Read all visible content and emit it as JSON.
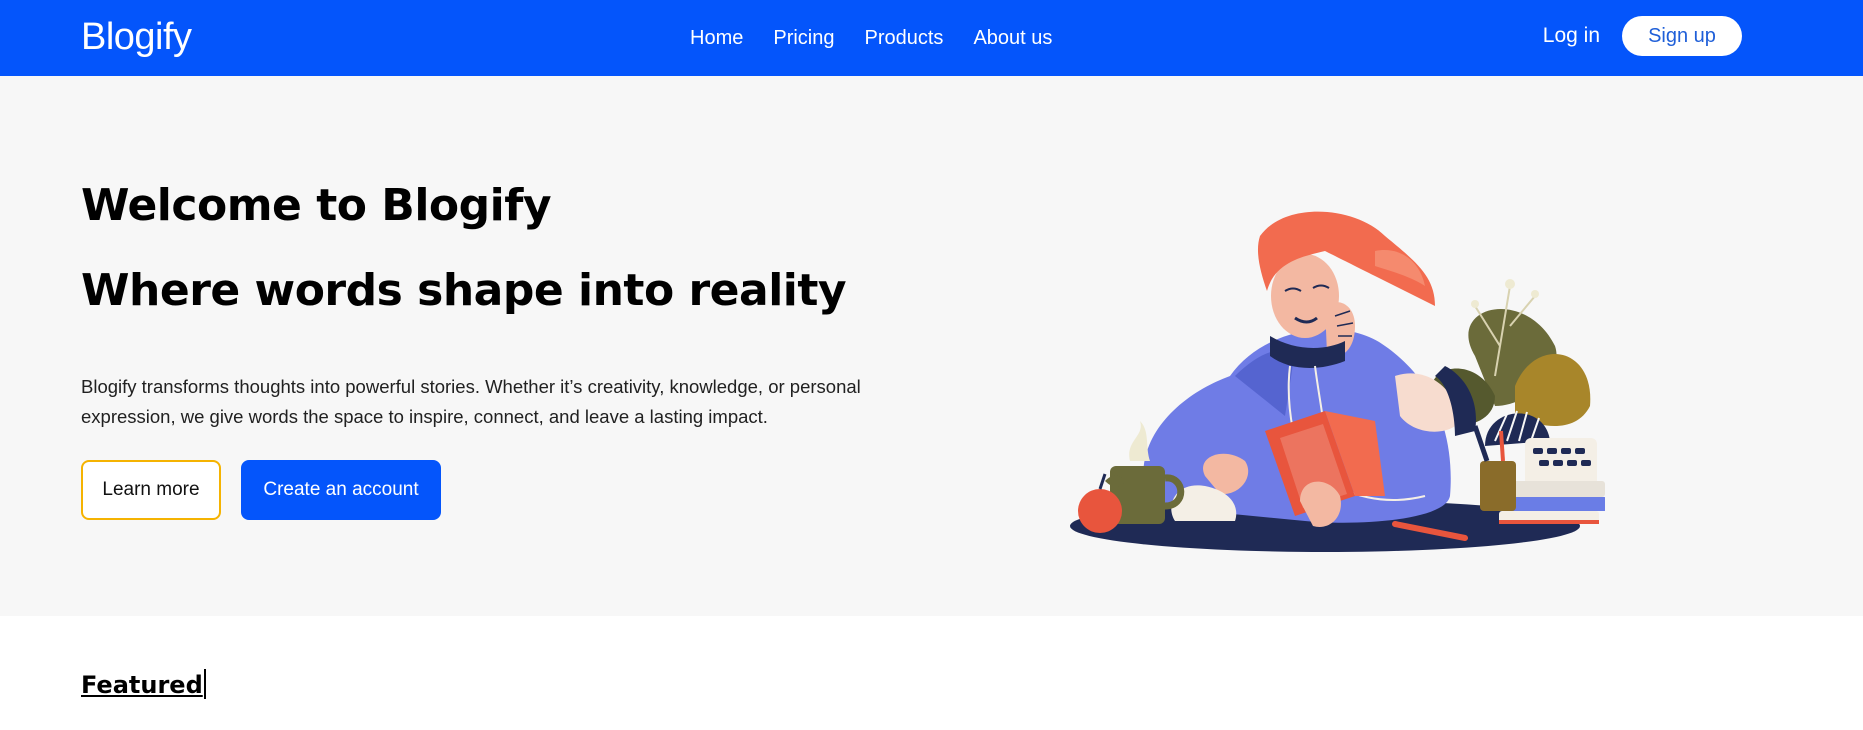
{
  "nav": {
    "brand": "Blogify",
    "links": [
      "Home",
      "Pricing",
      "Products",
      "About us"
    ],
    "login": "Log in",
    "signup": "Sign up"
  },
  "hero": {
    "title": "Welcome to Blogify",
    "subtitle": "Where words shape into reality",
    "description": "Blogify transforms thoughts into powerful stories. Whether it’s creativity, knowledge, or personal expression, we give words the space to inspire, connect, and leave a lasting impact.",
    "learn_more": "Learn more",
    "create_account": "Create an account",
    "illustration": "woman-reading-book-illustration"
  },
  "featured": {
    "heading": "Featured"
  },
  "colors": {
    "primary": "#0455fb",
    "hero_bg": "#f7f7f7",
    "learn_border": "#f5b301"
  }
}
